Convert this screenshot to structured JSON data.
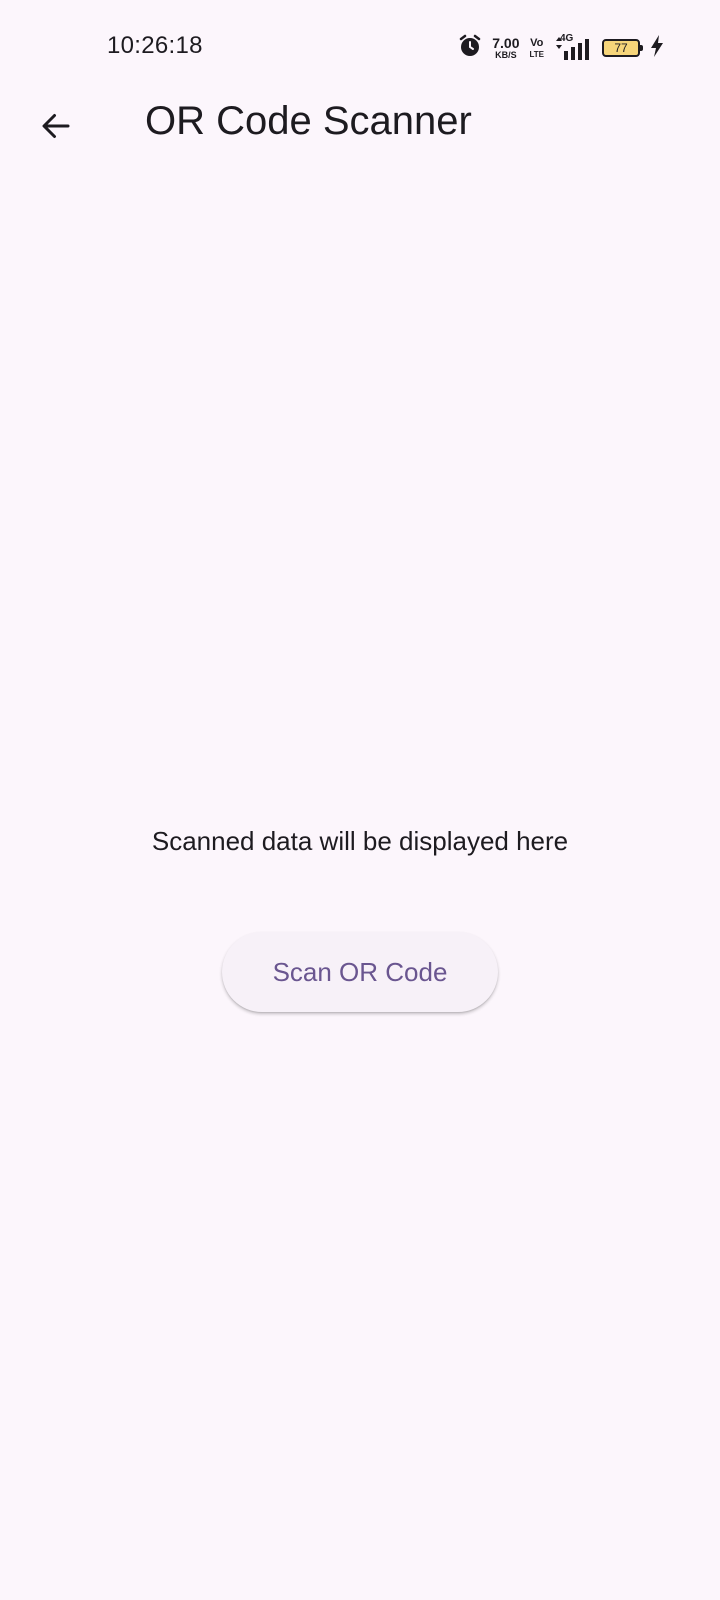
{
  "status_bar": {
    "time": "10:26:18",
    "net_speed_value": "7.00",
    "net_speed_unit": "KB/S",
    "volte_top": "Vo",
    "volte_bottom": "LTE",
    "network_type": "4G",
    "battery_level": "77",
    "icons": [
      "alarm-icon",
      "signal-icon",
      "battery-icon",
      "charging-icon"
    ]
  },
  "app_bar": {
    "title": "OR Code Scanner",
    "back_icon": "arrow-back-icon"
  },
  "main": {
    "scanned_text": "Scanned data will be displayed here",
    "scan_button_label": "Scan OR Code"
  },
  "colors": {
    "background": "#FCF6FC",
    "text": "#1D1B20",
    "button_bg": "#F7F1F8",
    "button_text": "#6A5690",
    "battery_fill": "#F6D57A"
  }
}
